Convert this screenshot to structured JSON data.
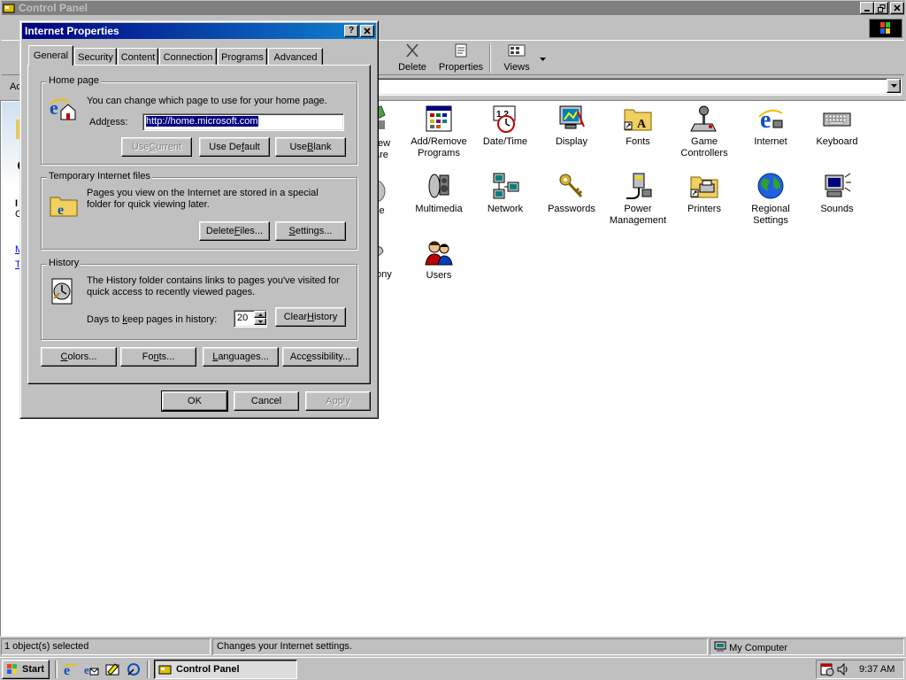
{
  "control_panel": {
    "title": "Control Panel",
    "toolbar": {
      "delete_label": "Delete",
      "properties_label": "Properties",
      "views_label": "Views"
    },
    "address_label_partial": "Ac",
    "icons": [
      {
        "label": "Add/Remove Programs",
        "icon": "add-remove-programs-icon"
      },
      {
        "label": "Date/Time",
        "icon": "date-time-icon"
      },
      {
        "label": "Display",
        "icon": "display-icon"
      },
      {
        "label": "Fonts",
        "icon": "fonts-folder-icon"
      },
      {
        "label": "Game Controllers",
        "icon": "joystick-icon"
      },
      {
        "label": "Internet",
        "icon": "internet-explorer-icon"
      },
      {
        "label": "Keyboard",
        "icon": "keyboard-icon"
      },
      {
        "label": "Multimedia",
        "icon": "multimedia-icon"
      },
      {
        "label": "Network",
        "icon": "network-icon"
      },
      {
        "label": "Passwords",
        "icon": "keys-icon"
      },
      {
        "label": "Power Management",
        "icon": "power-plug-icon"
      },
      {
        "label": "Printers",
        "icon": "printers-folder-icon"
      },
      {
        "label": "Regional Settings",
        "icon": "globe-icon"
      },
      {
        "label": "Sounds",
        "icon": "speaker-icon"
      },
      {
        "label": "Users",
        "icon": "users-icon"
      }
    ],
    "partial_labels": {
      "row1_line1": "ew",
      "row1_line2": "are",
      "row2": "se",
      "row3": "ony"
    },
    "status_bar": {
      "left": "1 object(s) selected",
      "middle": "Changes your Internet settings.",
      "right": "My Computer"
    }
  },
  "dialog": {
    "title": "Internet Properties",
    "tabs": [
      "General",
      "Security",
      "Content",
      "Connection",
      "Programs",
      "Advanced"
    ],
    "active_tab": "General",
    "home_page": {
      "group_label": "Home page",
      "description": "You can change which page to use for your home page.",
      "address_label": "Address:",
      "address_value": "http://home.microsoft.com",
      "use_current": "Use Current",
      "use_default": "Use Default",
      "use_blank": "Use Blank"
    },
    "temp_files": {
      "group_label": "Temporary Internet files",
      "description": "Pages you view on the Internet are stored in a special folder for quick viewing later.",
      "delete_files": "Delete Files...",
      "settings": "Settings..."
    },
    "history": {
      "group_label": "History",
      "description": "The History folder contains links to pages you've visited for quick access to recently viewed pages.",
      "days_label": "Days to keep pages in history:",
      "days_value": "20",
      "clear_history": "Clear History"
    },
    "bottom_buttons": {
      "colors": "Colors...",
      "fonts": "Fonts...",
      "languages": "Languages...",
      "accessibility": "Accessibility..."
    },
    "ok": "OK",
    "cancel": "Cancel",
    "apply": "Apply"
  },
  "taskbar": {
    "start_label": "Start",
    "task_label": "Control Panel",
    "clock": "9:37 AM"
  }
}
